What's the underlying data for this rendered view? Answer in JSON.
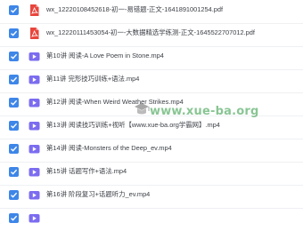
{
  "files": [
    {
      "type": "pdf",
      "icon": "pdf-file-icon",
      "checked": true,
      "name": "wx_12220108452618-初一-易错题-正文-1641891001254.pdf"
    },
    {
      "type": "pdf",
      "icon": "pdf-file-icon",
      "checked": true,
      "name": "wx_12220111453054-初一-大数据精选学练测-正文-1645522707012.pdf"
    },
    {
      "type": "video",
      "icon": "video-file-icon",
      "checked": true,
      "name": "第10讲 阅读-A Love Poem in Stone.mp4"
    },
    {
      "type": "video",
      "icon": "video-file-icon",
      "checked": true,
      "name": "第11讲 完形技巧训练+语法.mp4"
    },
    {
      "type": "video",
      "icon": "video-file-icon",
      "checked": true,
      "name": "第12讲 阅读-When Weird Weather Strikes.mp4"
    },
    {
      "type": "video",
      "icon": "video-file-icon",
      "checked": true,
      "name": "第13讲 阅读技巧训练+视听【www.xue-ba.org学霸网】.mp4"
    },
    {
      "type": "video",
      "icon": "video-file-icon",
      "checked": true,
      "name": "第14讲 阅读-Monsters of the Deep_ev.mp4"
    },
    {
      "type": "video",
      "icon": "video-file-icon",
      "checked": true,
      "name": "第15讲 话题写作+语法.mp4"
    },
    {
      "type": "video",
      "icon": "video-file-icon",
      "checked": true,
      "name": "第16讲 阶段复习+话题听力_ev.mp4"
    }
  ],
  "watermark": {
    "text": "www.xue-ba.org"
  },
  "colors": {
    "checkbox": "#3e86e8",
    "pdf": "#e8453c",
    "video": "#7b6cf0",
    "watermark": "#28963c"
  }
}
